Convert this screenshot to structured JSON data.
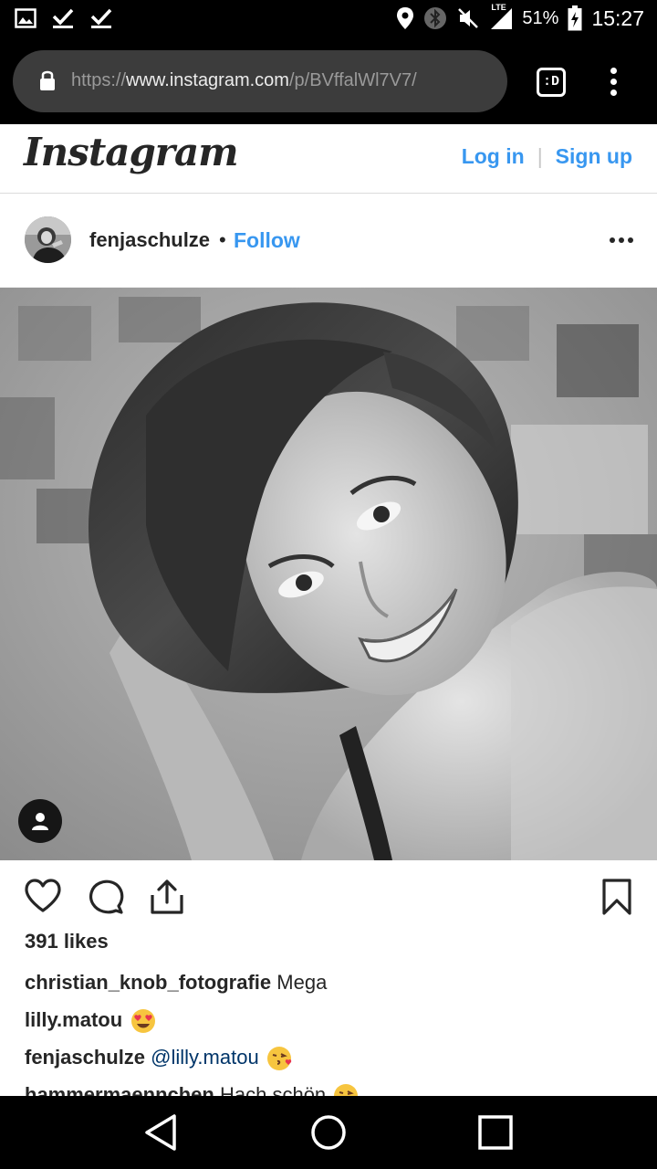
{
  "status_bar": {
    "battery_pct": "51%",
    "time": "15:27",
    "network": "LTE",
    "icons": [
      "image-icon",
      "check-icon",
      "check-icon",
      "location-icon",
      "bluetooth-icon",
      "mute-icon",
      "signal-icon",
      "battery-icon"
    ]
  },
  "browser": {
    "url_scheme": "https://",
    "url_host": "www.instagram.com",
    "url_path": "/p/BVffalWl7V7/",
    "tab_label": ":D"
  },
  "header": {
    "logo": "Instagram",
    "login": "Log in",
    "separator": "|",
    "signup": "Sign up"
  },
  "post": {
    "username": "fenjaschulze",
    "dot": "•",
    "follow": "Follow",
    "likes": "391 likes",
    "comments": [
      {
        "user": "christian_knob_fotografie",
        "text": "Mega",
        "emoji": ""
      },
      {
        "user": "lilly.matou",
        "text": "",
        "emoji": "heart-eyes"
      },
      {
        "user": "fenjaschulze",
        "mention": "@lilly.matou",
        "text": "",
        "emoji": "kiss"
      },
      {
        "user": "hammermaennchen",
        "text": "Hach schön",
        "emoji": "kiss"
      }
    ]
  },
  "colors": {
    "accent": "#3897f0",
    "text": "#262626",
    "mention": "#003569"
  }
}
